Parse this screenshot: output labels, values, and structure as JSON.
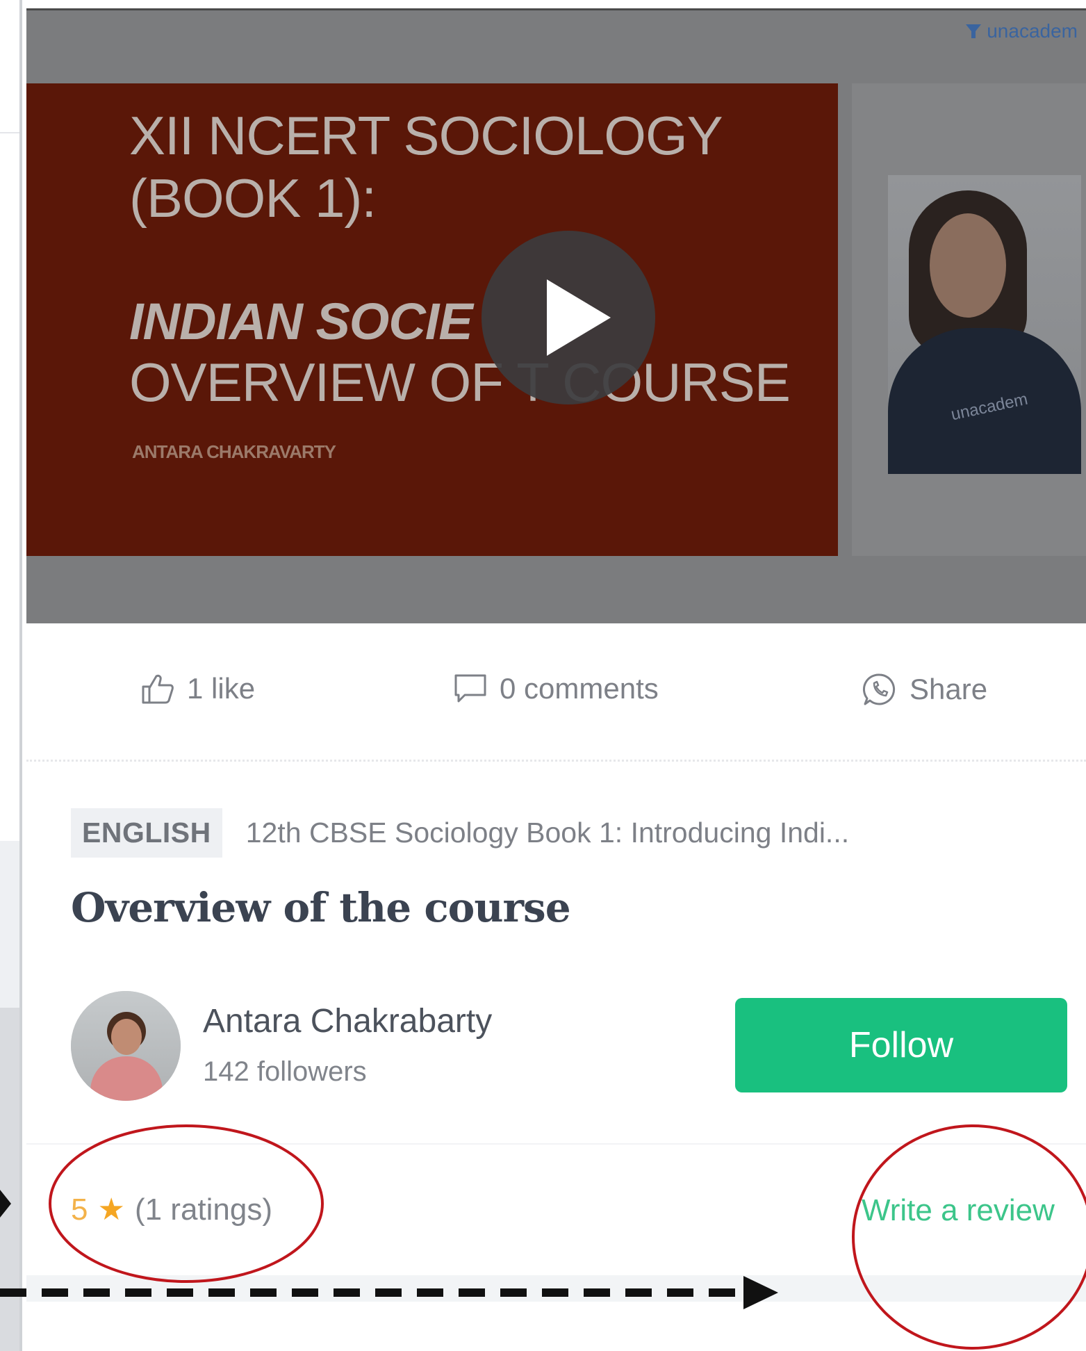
{
  "video": {
    "brand_text": "unacadem",
    "slide_line1": "XII NCERT SOCIOLOGY",
    "slide_line2": "(BOOK 1):",
    "slide_line3": "INDIAN SOCIE",
    "slide_line4": "OVERVIEW OF T   COURSE",
    "slide_author": "ANTARA CHAKRAVARTY",
    "presenter_shirt_text": "unacadem"
  },
  "actions": {
    "likes_label": "1 like",
    "comments_label": "0 comments",
    "share_label": "Share"
  },
  "lesson": {
    "language": "ENGLISH",
    "course_name": "12th CBSE Sociology Book 1: Introducing Indi...",
    "title": "Overview of the course"
  },
  "educator": {
    "name": "Antara Chakrabarty",
    "followers": "142 followers",
    "follow_label": "Follow"
  },
  "rating": {
    "value": "5",
    "count_label": "(1 ratings)",
    "write_review_label": "Write a review"
  },
  "colors": {
    "accent_green": "#19c07f",
    "rating_orange": "#f5a623",
    "annotation_red": "#c0161c"
  }
}
